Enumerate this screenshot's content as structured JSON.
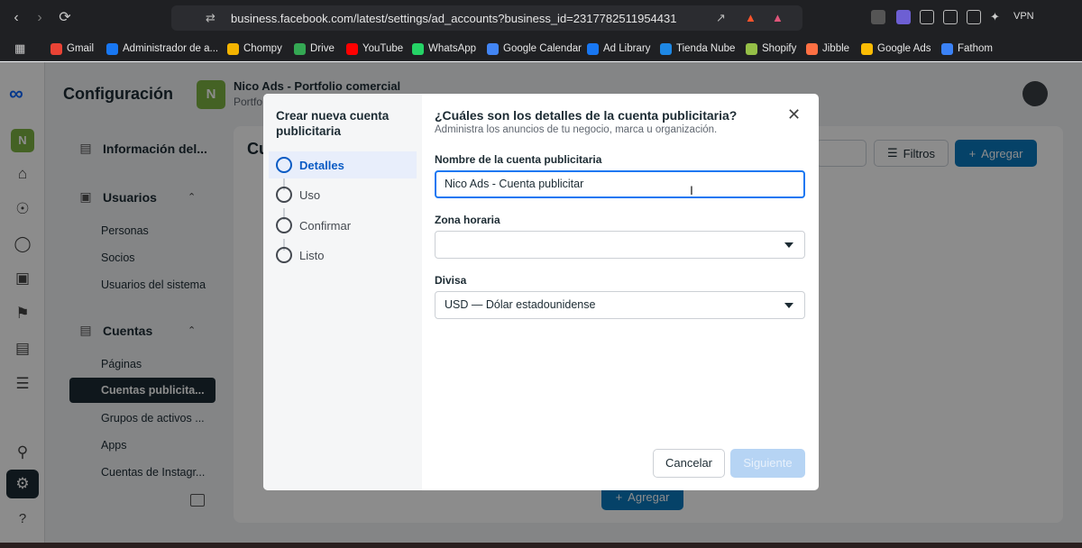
{
  "browser": {
    "url": "business.facebook.com/latest/settings/ad_accounts?business_id=2317782511954431",
    "vpn_label": "VPN",
    "bookmarks": [
      {
        "label": "Gmail",
        "color": "#ea4335"
      },
      {
        "label": "Administrador de a...",
        "color": "#1877f2"
      },
      {
        "label": "Chompy",
        "color": "#f4b400"
      },
      {
        "label": "Drive",
        "color": "#34a853"
      },
      {
        "label": "YouTube",
        "color": "#ff0000"
      },
      {
        "label": "WhatsApp",
        "color": "#25d366"
      },
      {
        "label": "Google Calendar",
        "color": "#4285f4"
      },
      {
        "label": "Ad Library",
        "color": "#1877f2"
      },
      {
        "label": "Tienda Nube",
        "color": "#1e88e5"
      },
      {
        "label": "Shopify",
        "color": "#95bf47"
      },
      {
        "label": "Jibble",
        "color": "#ff7043"
      },
      {
        "label": "Google Ads",
        "color": "#fbbc04"
      },
      {
        "label": "Fathom",
        "color": "#3b82f6"
      }
    ]
  },
  "app": {
    "title": "Configuración",
    "business_initial": "N",
    "portfolio_name": "Nico Ads - Portfolio comercial",
    "portfolio_sub": "Portfo",
    "page_heading": "Cu",
    "filters_label": "Filtros",
    "add_label": "Agregar"
  },
  "sidebar": {
    "info_label": "Información del...",
    "users_label": "Usuarios",
    "users_items": [
      "Personas",
      "Socios",
      "Usuarios del sistema"
    ],
    "accounts_label": "Cuentas",
    "accounts_items": [
      "Páginas",
      "Cuentas publicita...",
      "Grupos de activos ...",
      "Apps",
      "Cuentas de Instagr..."
    ]
  },
  "modal": {
    "wizard_title": "Crear nueva cuenta publicitaria",
    "steps": [
      "Detalles",
      "Uso",
      "Confirmar",
      "Listo"
    ],
    "active_step": "Detalles",
    "heading": "¿Cuáles son los detalles de la cuenta publicitaria?",
    "subheading": "Administra los anuncios de tu negocio, marca u organización.",
    "name_label": "Nombre de la cuenta publicitaria",
    "name_value": "Nico Ads - Cuenta publicitar",
    "timezone_label": "Zona horaria",
    "timezone_value": "",
    "currency_label": "Divisa",
    "currency_value": "USD — Dólar estadounidense",
    "cancel_label": "Cancelar",
    "next_label": "Siguiente"
  },
  "colors": {
    "accent": "#1877f2",
    "primary_button": "#0a78be",
    "disabled_button": "#b6d4f4",
    "brand_green": "#7cb342"
  }
}
